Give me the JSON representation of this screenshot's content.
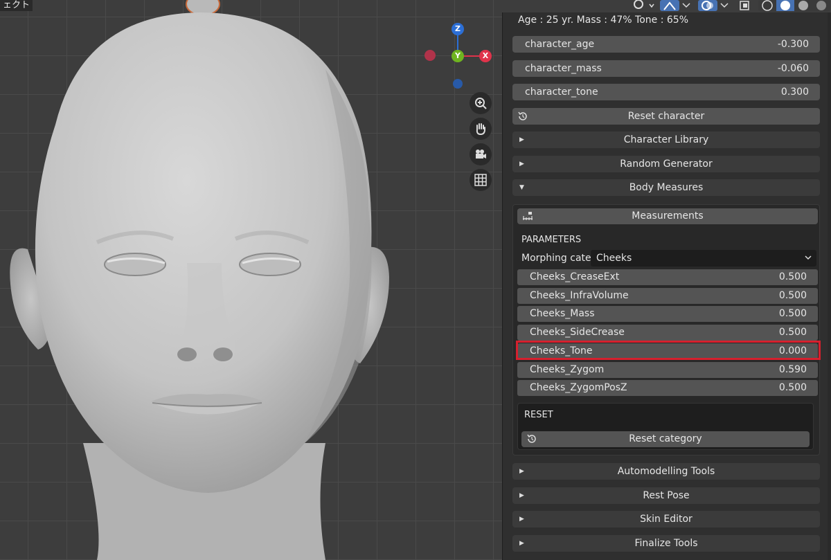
{
  "viewport": {
    "title_fragment": "ェクト",
    "gizmo": {
      "z": "Z",
      "y": "Y",
      "x": "X"
    },
    "nav_icons": [
      "zoom-icon",
      "hand-pan-icon",
      "camera-icon",
      "grid-icon"
    ]
  },
  "panel": {
    "info": "Age : 25 yr.  Mass : 47%  Tone : 65%",
    "character_fields": [
      {
        "label": "character_age",
        "value": "-0.300"
      },
      {
        "label": "character_mass",
        "value": "-0.060"
      },
      {
        "label": "character_tone",
        "value": "0.300"
      }
    ],
    "reset_character": "Reset character",
    "sections_top": [
      {
        "label": "Character Library",
        "state": "collapsed"
      },
      {
        "label": "Random Generator",
        "state": "collapsed"
      },
      {
        "label": "Body Measures",
        "state": "expanded"
      }
    ],
    "body_measures": {
      "measurements_button": "Measurements",
      "parameters_heading": "PARAMETERS",
      "morph_label": "Morphing cate..",
      "morph_value": "Cheeks",
      "params": [
        {
          "label": "Cheeks_CreaseExt",
          "value": "0.500"
        },
        {
          "label": "Cheeks_InfraVolume",
          "value": "0.500"
        },
        {
          "label": "Cheeks_Mass",
          "value": "0.500"
        },
        {
          "label": "Cheeks_SideCrease",
          "value": "0.500"
        },
        {
          "label": "Cheeks_Tone",
          "value": "0.000"
        },
        {
          "label": "Cheeks_Zygom",
          "value": "0.590"
        },
        {
          "label": "Cheeks_ZygomPosZ",
          "value": "0.500"
        }
      ],
      "reset_heading": "RESET",
      "reset_category": "Reset category"
    },
    "sections_bottom": [
      {
        "label": "Automodelling Tools",
        "state": "collapsed"
      },
      {
        "label": "Rest Pose",
        "state": "collapsed"
      },
      {
        "label": "Skin Editor",
        "state": "collapsed"
      },
      {
        "label": "Finalize Tools",
        "state": "collapsed"
      }
    ]
  },
  "colors": {
    "highlight": "#d6202e",
    "gizmo_z": "#2c6fd6",
    "gizmo_y": "#6fb420",
    "gizmo_x": "#e0334b"
  }
}
